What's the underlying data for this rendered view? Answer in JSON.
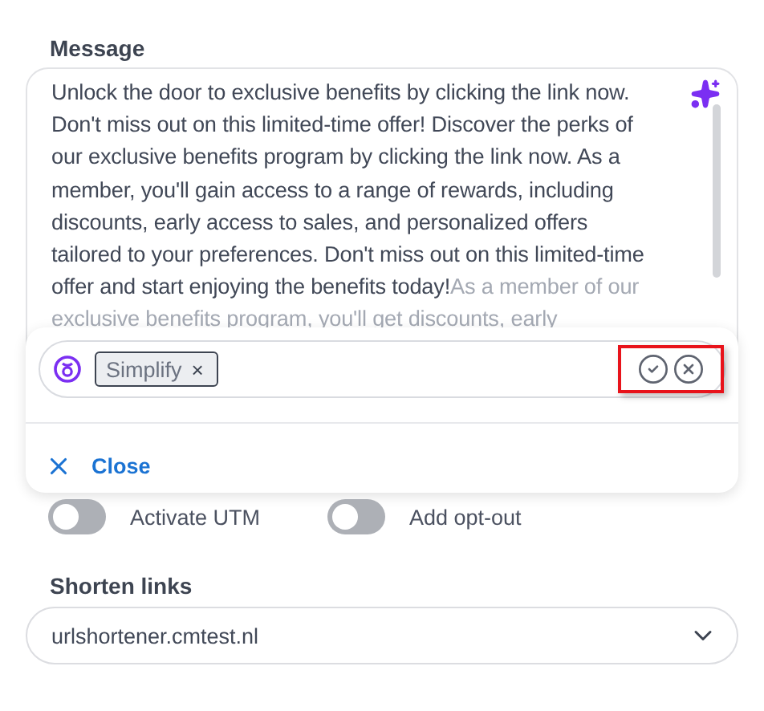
{
  "message": {
    "label": "Message",
    "text": "Unlock the door to exclusive benefits by clicking the link now. Don't miss out on this limited-time offer! Discover the perks of our exclusive benefits program by clicking the link now. As a member, you'll gain access to a range of rewards, including discounts, early access to sales, and personalized offers tailored to your preferences. Don't miss out on this limited-time offer and start enjoying the benefits today!",
    "suggestion": "As a member of our exclusive benefits program, you'll get discounts, early"
  },
  "assistant": {
    "chips": [
      {
        "label": "Simplify",
        "remove": "×"
      }
    ],
    "highlighted": true,
    "close": "Close"
  },
  "toggles": [
    {
      "label": "Activate UTM",
      "on": false
    },
    {
      "label": "Add opt-out",
      "on": false
    }
  ],
  "shorten": {
    "label": "Shorten links",
    "value": "urlshortener.cmtest.nl"
  }
}
